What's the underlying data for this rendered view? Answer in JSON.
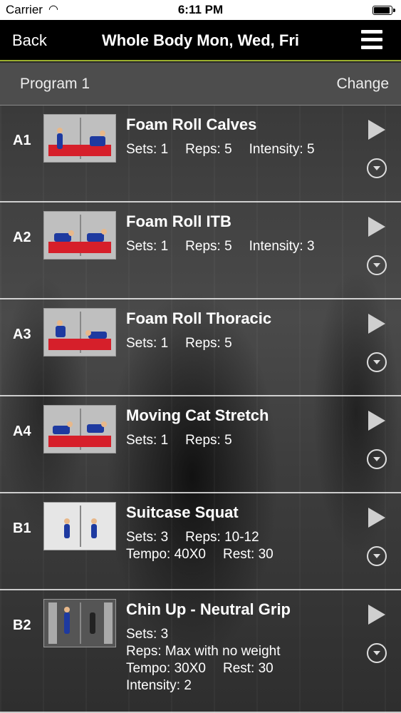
{
  "status_bar": {
    "carrier": "Carrier",
    "time": "6:11 PM"
  },
  "nav": {
    "back_label": "Back",
    "title": "Whole Body Mon, Wed, Fri"
  },
  "program": {
    "name": "Program 1",
    "change_label": "Change"
  },
  "exercises": [
    {
      "code": "A1",
      "name": "Foam Roll Calves",
      "lines": [
        [
          "Sets: 1",
          "Reps: 5",
          "Intensity: 5"
        ]
      ]
    },
    {
      "code": "A2",
      "name": "Foam Roll ITB",
      "lines": [
        [
          "Sets: 1",
          "Reps: 5",
          "Intensity: 3"
        ]
      ]
    },
    {
      "code": "A3",
      "name": "Foam Roll Thoracic",
      "lines": [
        [
          "Sets: 1",
          "Reps: 5"
        ]
      ]
    },
    {
      "code": "A4",
      "name": "Moving Cat Stretch",
      "lines": [
        [
          "Sets: 1",
          "Reps: 5"
        ]
      ]
    },
    {
      "code": "B1",
      "name": "Suitcase Squat",
      "lines": [
        [
          "Sets: 3",
          "Reps: 10-12"
        ],
        [
          "Tempo: 40X0",
          "Rest: 30"
        ]
      ]
    },
    {
      "code": "B2",
      "name": "Chin Up - Neutral Grip",
      "lines": [
        [
          "Sets: 3"
        ],
        [
          "Reps: Max with no weight"
        ],
        [
          "Tempo: 30X0",
          "Rest: 30"
        ],
        [
          "Intensity: 2"
        ]
      ]
    }
  ],
  "colors": {
    "accent": "#9aae2e",
    "navbar": "#000000",
    "program_bar": "#4d4d4d"
  }
}
